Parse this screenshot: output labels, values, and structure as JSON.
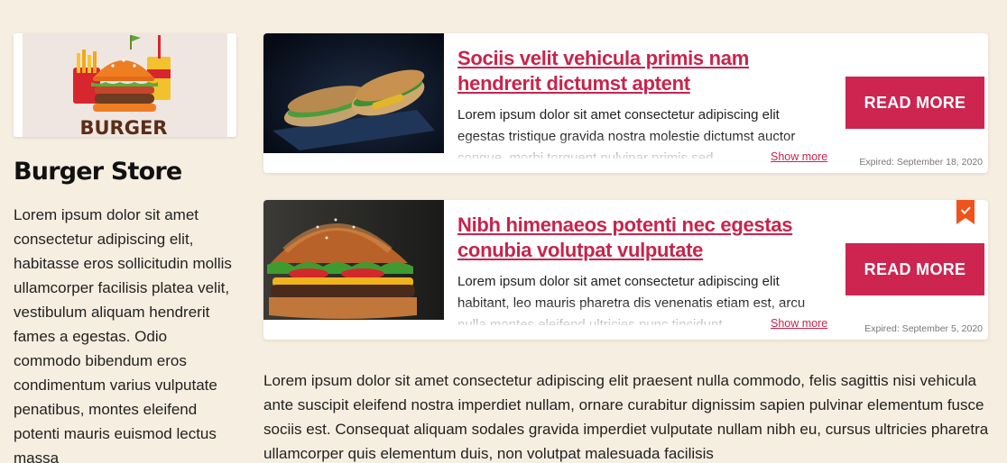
{
  "store": {
    "logo_text": "BURGER",
    "name": "Burger Store",
    "description": "Lorem ipsum dolor sit amet consectetur adipiscing elit, habitasse eros sollicitudin mollis ullamcorper facilisis platea velit, vestibulum aliquam hendrerit fames a egestas. Odio commodo bibendum eros condimentum varius vulputate penatibus, montes eleifend potenti mauris euismod lectus massa"
  },
  "deals": [
    {
      "title": "Sociis velit vehicula primis nam hendrerit dictumst aptent",
      "description": "Lorem ipsum dolor sit amet consectetur adipiscing elit egestas tristique gravida nostra molestie dictumst auctor congue, morbi torquent pulvinar primis sed",
      "show_more": "Show more",
      "button": "READ MORE",
      "expiry": "Expired: September 18, 2020",
      "image": "sandwich-photo",
      "verified": false
    },
    {
      "title": "Nibh himenaeos potenti nec egestas conubia volutpat vulputate",
      "description": "Lorem ipsum dolor sit amet consectetur adipiscing elit habitant, leo mauris pharetra dis venenatis etiam est, arcu nulla montes eleifend ultricies nunc tincidunt",
      "show_more": "Show more",
      "button": "READ MORE",
      "expiry": "Expired: September 5, 2020",
      "image": "burger-photo",
      "verified": true,
      "verified_icon": "check-badge-icon"
    }
  ],
  "content": {
    "paragraph": "Lorem ipsum dolor sit amet consectetur adipiscing elit praesent nulla commodo, felis sagittis nisi vehicula ante suscipit eleifend nostra imperdiet nullam, ornare curabitur dignissim sapien pulvinar elementum fusce sociis est. Consequat aliquam sodales gravida imperdiet vulputate nullam nibh eu, cursus ultricies pharetra ullamcorper quis elementum duis, non volutpat malesuada facilisis"
  },
  "colors": {
    "background": "#f6eee0",
    "accent": "#cd2550",
    "badge": "#f0521c"
  }
}
